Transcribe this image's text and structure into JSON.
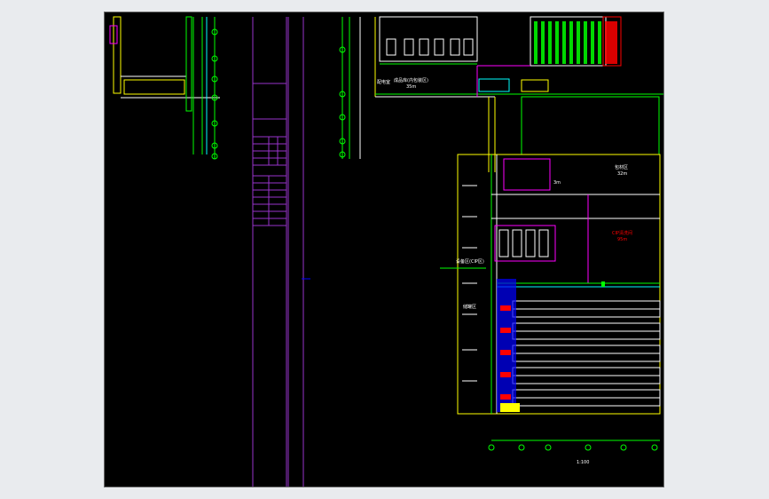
{
  "viewer": {
    "background": "#000000",
    "frame_color": "#e9ebee"
  },
  "colors": {
    "green": "#00ff00",
    "magenta": "#ff00ff",
    "cyan": "#00ffff",
    "yellow": "#ffff00",
    "white": "#ffffff",
    "red": "#ff0000",
    "blue": "#0000ff",
    "purple": "#9933cc"
  },
  "labels": {
    "area_top_left": "配电室",
    "area_top_mid": "成品库(内包装区)",
    "area_top_mid_sub": "35m",
    "area_right_mid": "包材区",
    "area_right_mid_sub": "32m",
    "area_red": "CIP清洗间",
    "area_red_sub": "95m",
    "callout_left": "设备区(CIP区)",
    "callout_left2": "储罐区",
    "bottom_scale": "1:100",
    "small_note": "3m"
  }
}
